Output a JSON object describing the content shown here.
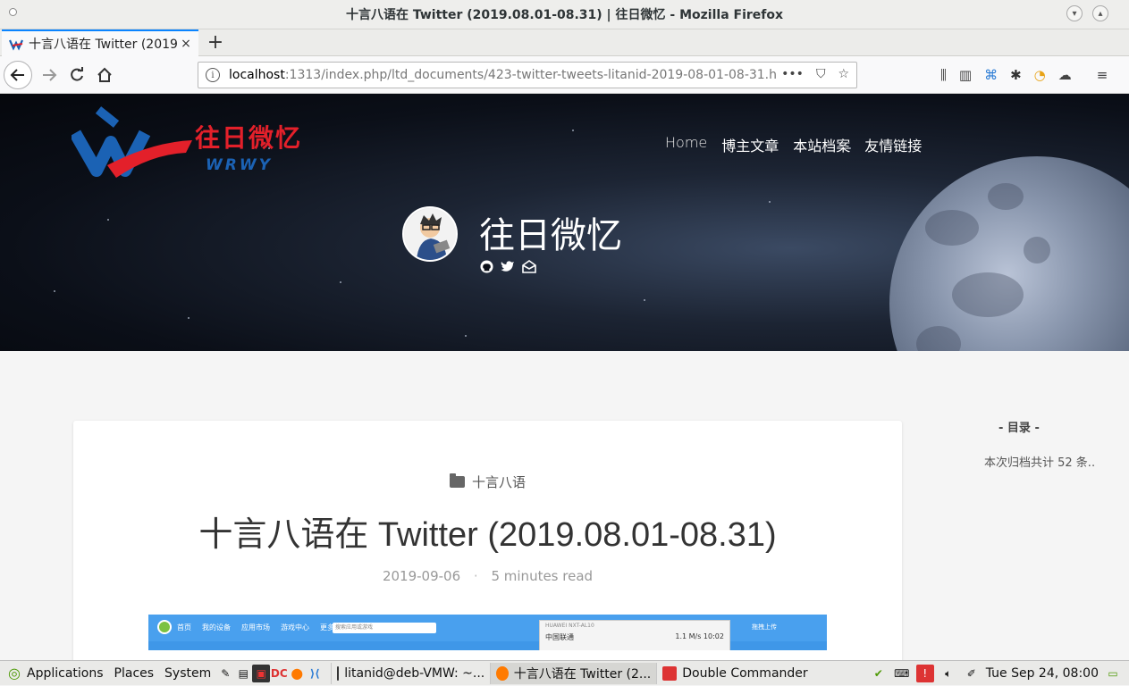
{
  "window": {
    "title": "十言八语在 Twitter (2019.08.01-08.31) | 往日微忆 - Mozilla Firefox"
  },
  "tab": {
    "title": "十言八语在 Twitter (2019",
    "close": "×",
    "new_tab": "+"
  },
  "url": {
    "host": "localhost",
    "path": ":1313/index.php/ltd_documents/423-twitter-tweets-litanid-2019-08-01-08-31.h"
  },
  "site": {
    "logo_cn": "往日微忆",
    "logo_en": "WRWY",
    "nav": [
      "Home",
      "博主文章",
      "本站档案",
      "友情链接"
    ],
    "name": "往日微忆"
  },
  "post": {
    "category": "十言八语",
    "title": "十言八语在 Twitter (2019.08.01-08.31)",
    "date": "2019-09-06",
    "separator": "·",
    "read_time": "5 minutes read"
  },
  "embedded_screenshot": {
    "links": [
      "首页",
      "我的设备",
      "应用市场",
      "游戏中心",
      "更多服务"
    ],
    "search_placeholder": "搜索应用或游戏",
    "phone_title": "HUAWEI NXT-AL10",
    "phone_carrier": "中国联通",
    "phone_status": "1.1 M/s  10:02",
    "upload": "拖拽上传"
  },
  "sidebar": {
    "title": "- 目录 -",
    "text": "本次归档共计 52 条.."
  },
  "taskbar": {
    "applications": "Applications",
    "places": "Places",
    "system": "System",
    "tasks": [
      "litanid@deb-VMW: ~...",
      "十言八语在 Twitter (2...",
      "Double Commander"
    ],
    "clock": "Tue Sep 24, 08:00"
  },
  "colors": {
    "accent": "#0a84ff",
    "logo_red": "#e3202a",
    "logo_blue": "#1b62b4"
  }
}
